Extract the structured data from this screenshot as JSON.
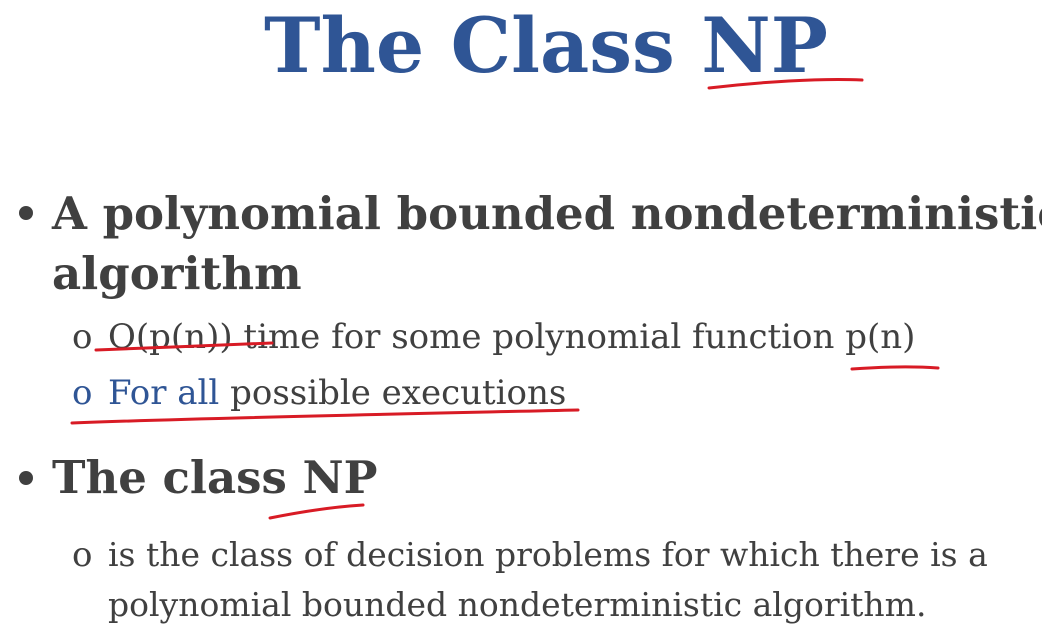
{
  "title": "The Class NP",
  "bullets": [
    {
      "text_line1": "A polynomial bounded nondeterministic",
      "text_line2": "algorithm",
      "subitems": [
        {
          "marker": "o",
          "text": "O(p(n)) time for some polynomial function p(n)"
        },
        {
          "marker": "o",
          "highlight": "For all",
          "text": "possible executions"
        }
      ]
    },
    {
      "text_line1": "The class NP",
      "subitems": [
        {
          "marker": "o",
          "text_line1": "is the class of decision problems for which there is a",
          "text_line2": "polynomial bounded nondeterministic algorithm."
        }
      ]
    }
  ],
  "colors": {
    "title": "#2f5595",
    "body_text": "#404040",
    "highlight": "#2f5595",
    "annotation_ink": "#d81b25"
  }
}
